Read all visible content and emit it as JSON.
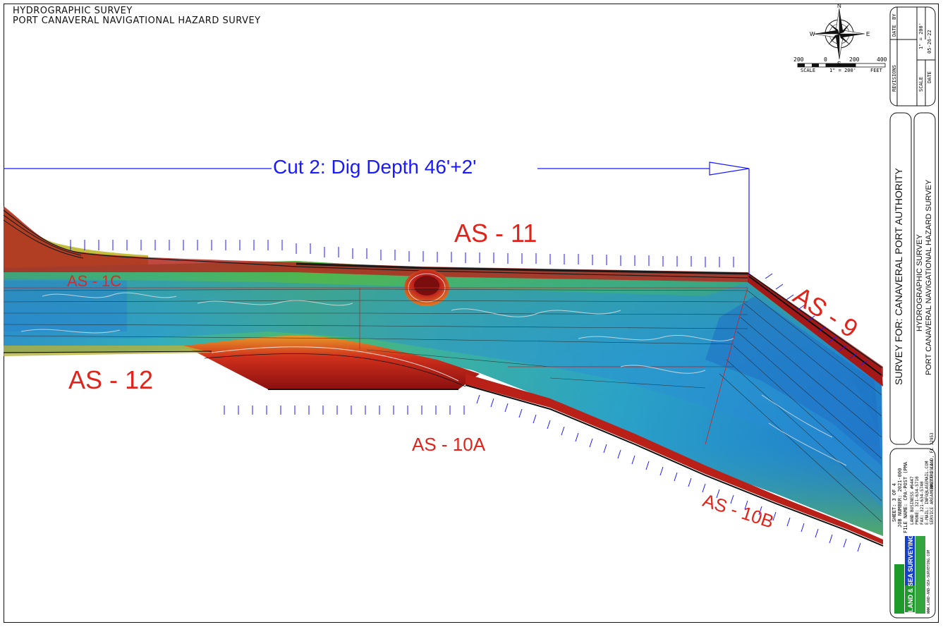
{
  "header": {
    "line1": "HYDROGRAPHIC SURVEY",
    "line2": "PORT CANAVERAL NAVIGATIONAL HAZARD SURVEY"
  },
  "cut_label": "Cut 2: Dig Depth 46'+2'",
  "areas": {
    "as1c": "AS - 1C",
    "as11": "AS - 11",
    "as12": "AS - 12",
    "as9": "AS - 9",
    "as10a": "AS - 10A",
    "as10b": "AS - 10B"
  },
  "scale_bar": {
    "left_value": "200",
    "zero": "0",
    "mid_value": "200",
    "right_value": "400",
    "caption_left": "SCALE",
    "caption_mid": "1\" = 200'",
    "caption_right": "FEET"
  },
  "compass": {
    "n": "N",
    "s": "S",
    "e": "E",
    "w": "W"
  },
  "title_block": {
    "revisions_label": "REVISIONS",
    "by_label": "BY",
    "date_label": "DATE",
    "scale_label": "SCALE",
    "scale_value": "1\" = 200'",
    "date2_label": "DATE",
    "date2_value": "05-26-22",
    "survey_for": "SURVEY FOR: CANAVERAL PORT AUTHORITY",
    "survey_title1": "HYDROGRAPHIC SURVEY",
    "survey_title2": "PORT CANAVERAL NAVIGATIONAL HAZARD SURVEY",
    "sheet": "SHEET: 3 OF 4",
    "job_number": "JOB NUMBER: 2021-000",
    "file_name": "FILE NAME: CPA-POST (PMA",
    "firm_lines": [
      "LAND BUSINESS #6447",
      "PHONE: 321-634-5710",
      "FAX: 321-634-5740",
      "E-MAIL: INFO@LASEMAIL.COM",
      "SERVICE AREA: BREVARD CO.",
      "MERRITT ISLAND, FL 32953"
    ],
    "website": "WWW.LAND-AND-SEA-SURVEYING.COM",
    "logo_text": "LAND & SEA SURVEYING"
  },
  "colors": {
    "channel_deep": "#1e7fd0",
    "channel_mid": "#2bb0b8",
    "channel_green": "#4cb83a",
    "bank_yellow": "#c9c33a",
    "slope_red": "#c01818",
    "label_red": "#e0241c",
    "cut_blue": "#1a1aff"
  }
}
